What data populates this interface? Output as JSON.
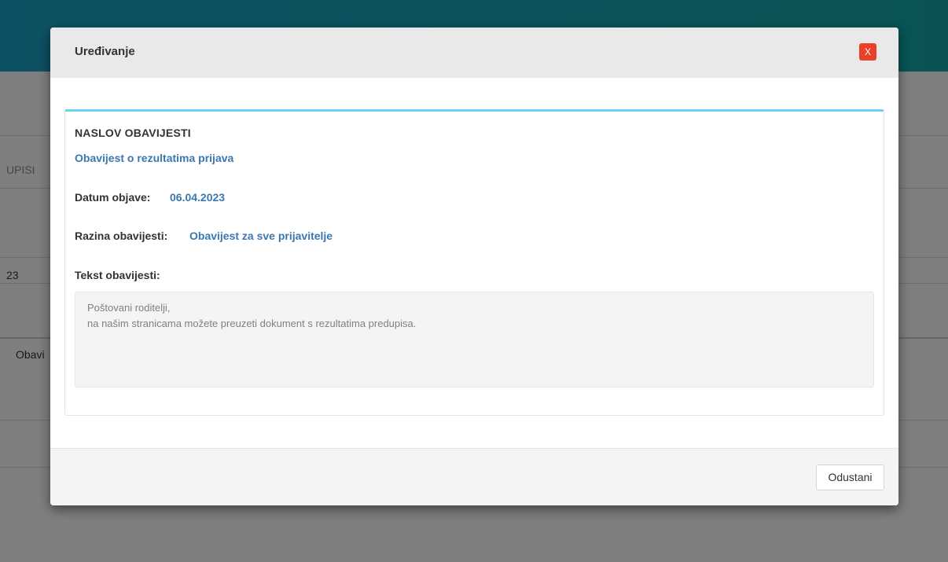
{
  "background": {
    "tab_fragment": "UPISI",
    "date_fragment": "23",
    "item_fragment": "Obavi"
  },
  "modal": {
    "title": "Uređivanje",
    "close_label": "X",
    "notice": {
      "title_label": "NASLOV OBAVIJESTI",
      "title_value": "Obavijest o rezultatima prijava",
      "date_label": "Datum objave:",
      "date_value": "06.04.2023",
      "level_label": "Razina obavijesti:",
      "level_value": "Obavijest za sve prijavitelje",
      "text_label": "Tekst obavijesti:",
      "text_lines": [
        "Poštovani roditelji,",
        "na našim stranicama možete preuzeti dokument s rezultatima predupisa."
      ]
    },
    "cancel_label": "Odustani"
  },
  "colors": {
    "header_accent": "#17a7be",
    "link_blue": "#3a78b0",
    "panel_top_border": "#6fcff0",
    "close_red": "#e8402a"
  }
}
